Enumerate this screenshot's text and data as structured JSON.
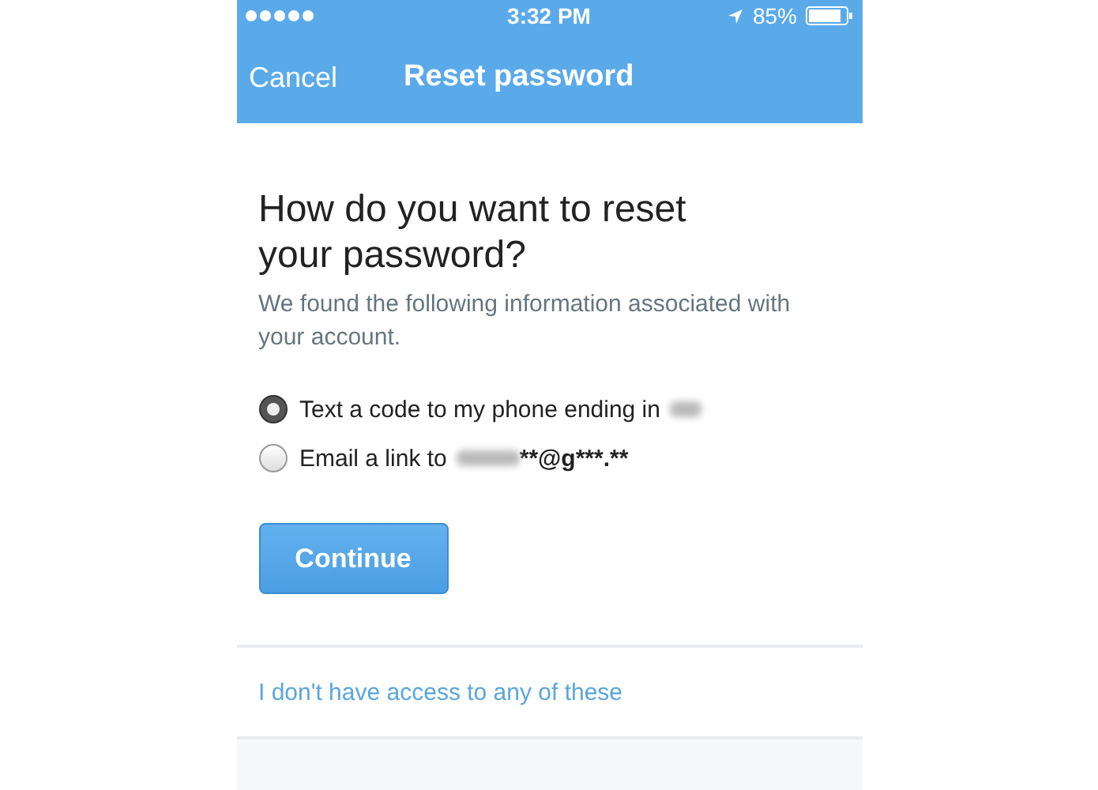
{
  "status_bar": {
    "time": "3:32 PM",
    "battery": "85%"
  },
  "nav": {
    "cancel": "Cancel",
    "title": "Reset password"
  },
  "heading": "How do you want to reset your password?",
  "description": "We found the following information associated with your account.",
  "options": [
    {
      "label": "Text a code to my phone ending in",
      "redacted": true,
      "selected": true
    },
    {
      "label": "Email a link to",
      "redacted": true,
      "suffix": "**@g***.**",
      "selected": false
    }
  ],
  "continue_button": "Continue",
  "help_link": "I don't have access to any of these"
}
